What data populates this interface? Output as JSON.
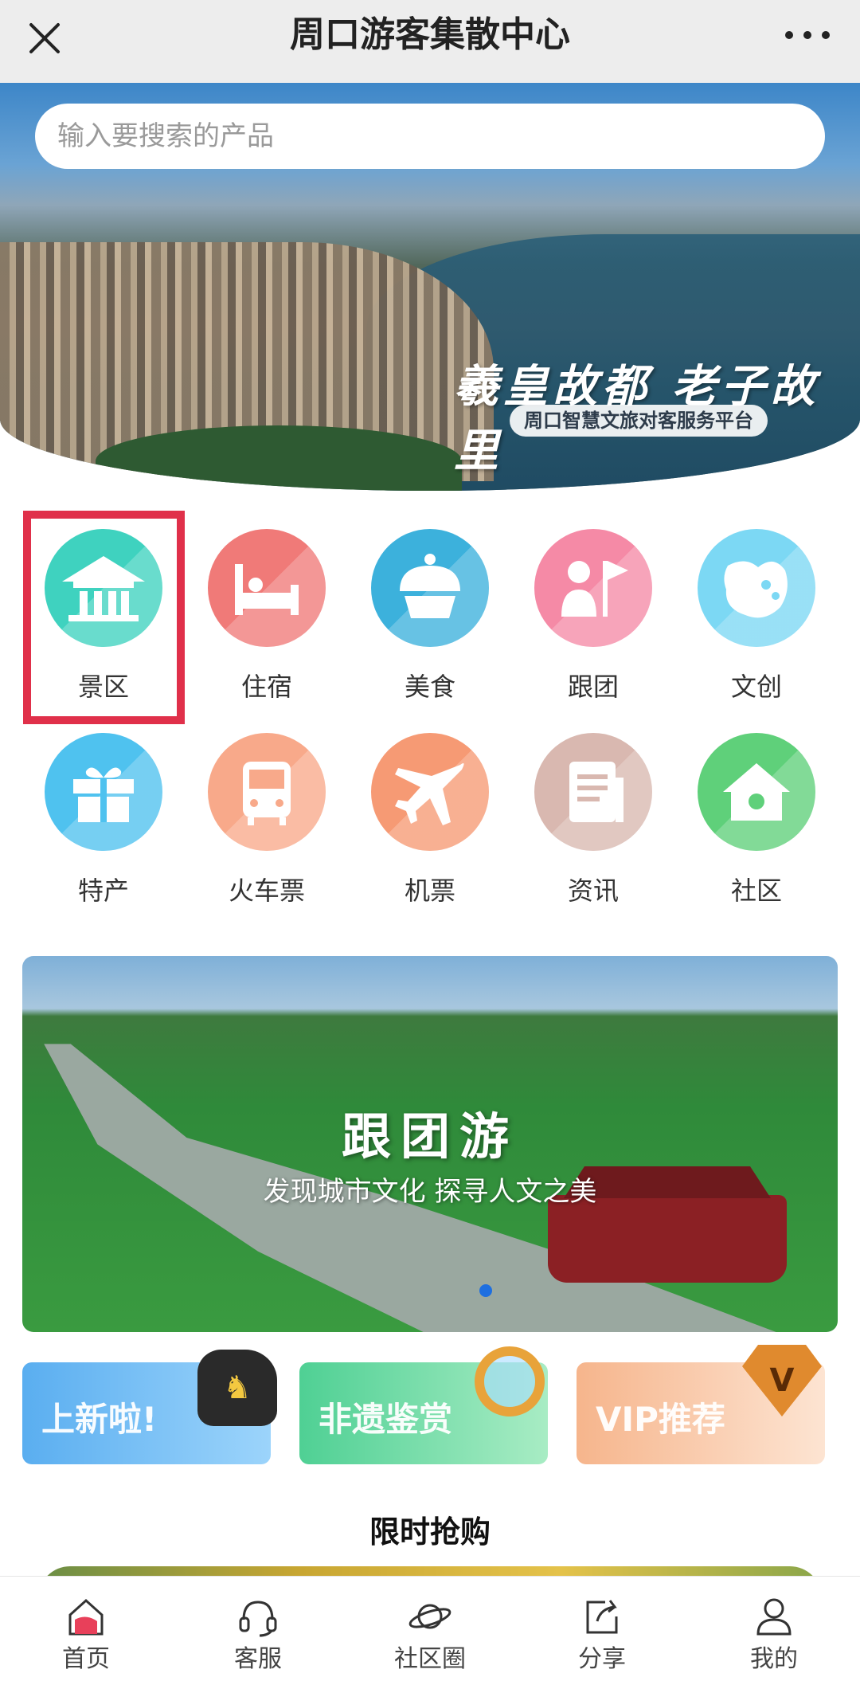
{
  "nav": {
    "title": "周口游客集散中心",
    "close_icon": "close-icon",
    "more_icon": "more-icon"
  },
  "hero": {
    "search_placeholder": "输入要搜索的产品",
    "slogan": "羲皇故都 老子故里",
    "slogan_sub": "周口智慧文旅对客服务平台"
  },
  "categories": [
    {
      "label": "景区",
      "icon": "scenic-area-icon",
      "color": "#3fd2bf",
      "glyph": "🏛"
    },
    {
      "label": "住宿",
      "icon": "hotel-bed-icon",
      "color": "#f07a78",
      "glyph": "🛏"
    },
    {
      "label": "美食",
      "icon": "cake-icon",
      "color": "#3cb1dc",
      "glyph": "🧁"
    },
    {
      "label": "跟团",
      "icon": "tour-group-flag-icon",
      "color": "#f58aa6",
      "glyph": "⚑"
    },
    {
      "label": "文创",
      "icon": "cultural-creative-icon",
      "color": "#7cd8f4",
      "glyph": "❖"
    },
    {
      "label": "特产",
      "icon": "gift-box-icon",
      "color": "#4fc2ef",
      "glyph": "🎁"
    },
    {
      "label": "火车票",
      "icon": "train-icon",
      "color": "#f8a98a",
      "glyph": "🚆"
    },
    {
      "label": "机票",
      "icon": "airplane-icon",
      "color": "#f69a74",
      "glyph": "✈"
    },
    {
      "label": "资讯",
      "icon": "news-icon",
      "color": "#d9b8b0",
      "glyph": "≣"
    },
    {
      "label": "社区",
      "icon": "home-community-icon",
      "color": "#5fd07a",
      "glyph": "⌂"
    }
  ],
  "banner": {
    "title": "跟团游",
    "subtitle": "发现城市文化 探寻人文之美"
  },
  "promos": [
    {
      "label": "上新啦!",
      "icon": "toy-horse-icon"
    },
    {
      "label": "非遗鉴赏",
      "icon": "magnifier-icon"
    },
    {
      "label": "VIP推荐",
      "icon": "vip-diamond-icon",
      "badge": "V"
    }
  ],
  "section": {
    "title": "限时抢购"
  },
  "tabs": [
    {
      "label": "首页",
      "icon": "home-icon",
      "active": true,
      "color": "#e8405a"
    },
    {
      "label": "客服",
      "icon": "headset-icon"
    },
    {
      "label": "社区圈",
      "icon": "planet-icon"
    },
    {
      "label": "分享",
      "icon": "share-icon"
    },
    {
      "label": "我的",
      "icon": "user-icon"
    }
  ]
}
